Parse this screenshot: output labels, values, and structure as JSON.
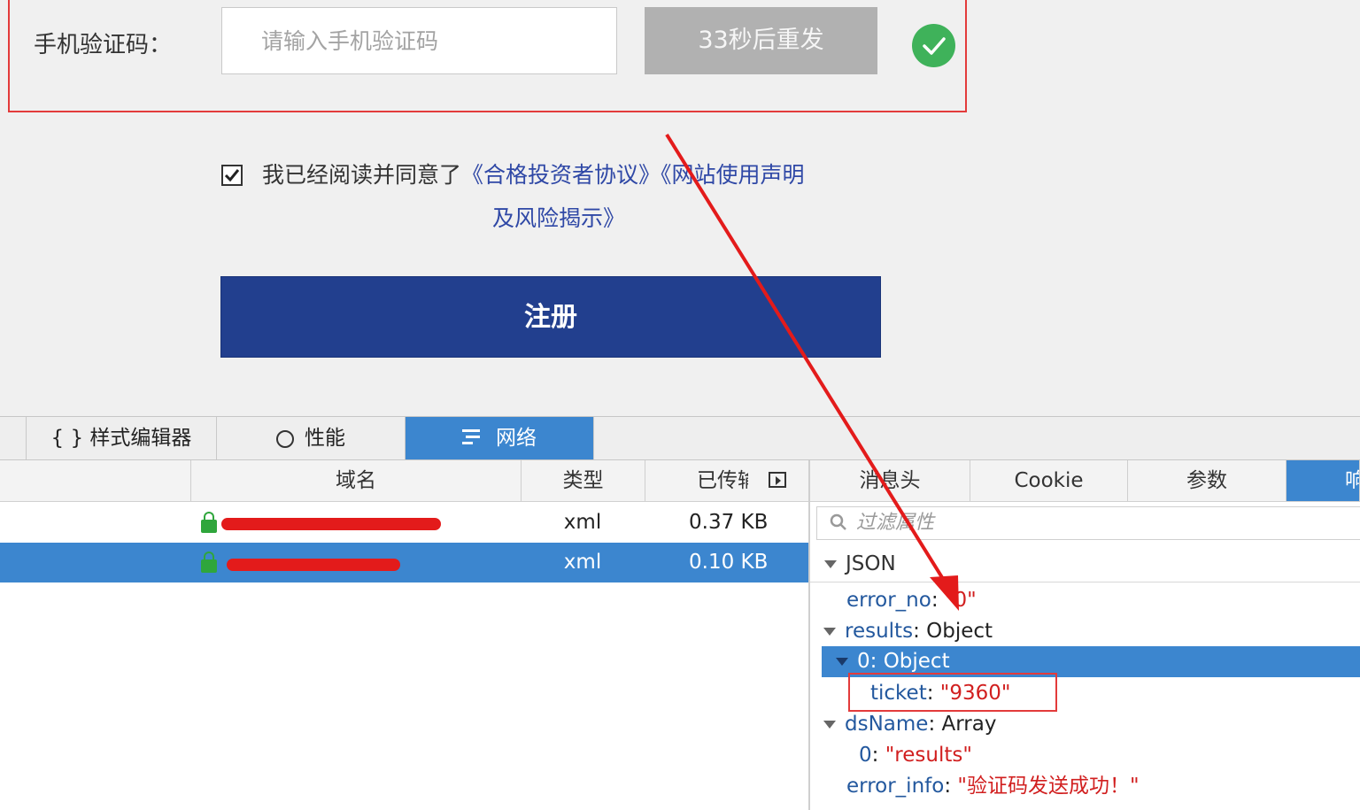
{
  "form": {
    "phone_code_label": "手机验证码：",
    "phone_code_placeholder": "请输入手机验证码",
    "resend_label": "33秒后重发",
    "agree_text": "我已经阅读并同意了",
    "link1": "《合格投资者协议》",
    "link2": "《网站使用声明",
    "link2_cont": "及风险揭示》",
    "register_label": "注册"
  },
  "devtools": {
    "tabs": [
      "{ } 样式编辑器",
      "性能",
      "网络"
    ],
    "columns": {
      "domain": "域名",
      "type": "类型",
      "transferred": "已传输"
    },
    "rows": [
      {
        "type": "xml",
        "size": "0.37 KB"
      },
      {
        "type": "xml",
        "size": "0.10 KB"
      }
    ],
    "right_tabs": [
      "消息头",
      "Cookie",
      "参数",
      "响应"
    ],
    "filter_placeholder": "过滤属性",
    "json_header": "JSON",
    "json": {
      "error_no_key": "error_no",
      "error_no_val": "\"0\"",
      "results_key": "results",
      "results_val": "Object",
      "item0": "0: Object",
      "ticket_key": "ticket",
      "ticket_val": "\"9360\"",
      "dsname_key": "dsName",
      "dsname_val": "Array",
      "ds0_key": "0",
      "ds0_val": "\"results\"",
      "error_info_key": "error_info",
      "error_info_val": "\"验证码发送成功！\""
    }
  },
  "colors": {
    "accent": "#3c86cf",
    "register": "#223f8e",
    "success": "#3fb25a",
    "annotation": "#e33b3b"
  }
}
